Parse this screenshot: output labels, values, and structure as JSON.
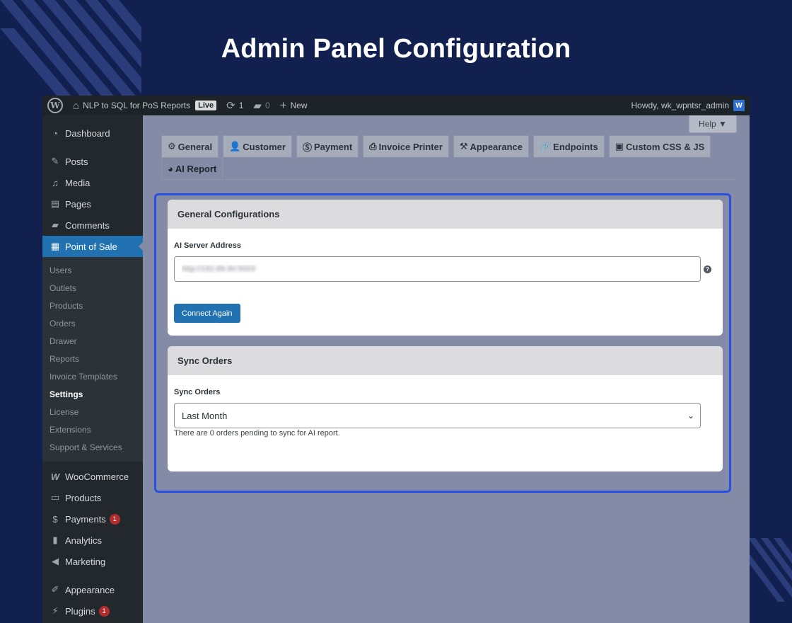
{
  "page": {
    "heading": "Admin Panel Configuration",
    "colors": {
      "background": "#12204f",
      "accent": "#2271b1",
      "highlight_border": "#2750e0"
    }
  },
  "admin_bar": {
    "site_name": "NLP to SQL for PoS Reports",
    "live_badge": "Live",
    "updates_count": "1",
    "comments_count": "0",
    "new_label": "New",
    "greeting": "Howdy, wk_wpntsr_admin",
    "avatar_letter": "W"
  },
  "sidebar": {
    "top_items": [
      {
        "label": "Dashboard",
        "icon": "dashboard-icon"
      },
      {
        "label": "Posts",
        "icon": "pin-icon"
      },
      {
        "label": "Media",
        "icon": "media-icon"
      },
      {
        "label": "Pages",
        "icon": "pages-icon"
      },
      {
        "label": "Comments",
        "icon": "comment-icon"
      },
      {
        "label": "Point of Sale",
        "icon": "calculator-icon"
      }
    ],
    "submenu": [
      {
        "label": "Users"
      },
      {
        "label": "Outlets"
      },
      {
        "label": "Products"
      },
      {
        "label": "Orders"
      },
      {
        "label": "Drawer"
      },
      {
        "label": "Reports"
      },
      {
        "label": "Invoice Templates"
      },
      {
        "label": "Settings"
      },
      {
        "label": "License"
      },
      {
        "label": "Extensions"
      },
      {
        "label": "Support & Services"
      }
    ],
    "bottom_items": [
      {
        "label": "WooCommerce",
        "icon": "woocommerce-icon"
      },
      {
        "label": "Products",
        "icon": "archive-icon"
      },
      {
        "label": "Payments",
        "icon": "dollar-icon",
        "badge": "1"
      },
      {
        "label": "Analytics",
        "icon": "bar-chart-icon"
      },
      {
        "label": "Marketing",
        "icon": "megaphone-icon"
      },
      {
        "label": "Appearance",
        "icon": "brush-icon"
      },
      {
        "label": "Plugins",
        "icon": "plugin-icon",
        "badge": "1"
      }
    ]
  },
  "help_button": "Help ▼",
  "tabs": [
    {
      "label": "General",
      "icon": "gear-icon"
    },
    {
      "label": "Customer",
      "icon": "user-icon"
    },
    {
      "label": "Payment",
      "icon": "dollar-circle-icon"
    },
    {
      "label": "Invoice Printer",
      "icon": "printer-icon"
    },
    {
      "label": "Appearance",
      "icon": "hammer-icon"
    },
    {
      "label": "Endpoints",
      "icon": "link-icon"
    },
    {
      "label": "Custom CSS & JS",
      "icon": "code-file-icon"
    },
    {
      "label": "AI Report",
      "icon": "pie-chart-icon"
    }
  ],
  "general_config": {
    "heading": "General Configurations",
    "server_label": "AI Server Address",
    "server_value": "http://192.89.90:5003",
    "help_tip": "?",
    "button_label": "Connect Again"
  },
  "sync_orders": {
    "heading": "Sync Orders",
    "field_label": "Sync Orders",
    "selected_option": "Last Month",
    "description": "There are 0 orders pending to sync for AI report."
  }
}
